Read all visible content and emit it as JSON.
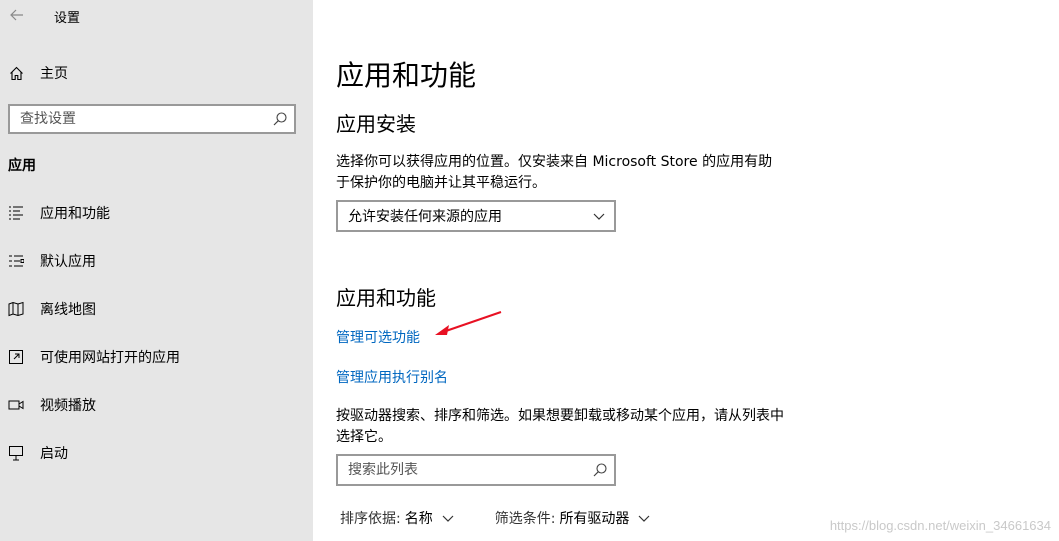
{
  "window": {
    "title": "设置"
  },
  "sidebar": {
    "home_label": "主页",
    "search_placeholder": "查找设置",
    "section_label": "应用",
    "items": [
      {
        "label": "应用和功能",
        "icon": "list-icon"
      },
      {
        "label": "默认应用",
        "icon": "default-apps-icon"
      },
      {
        "label": "离线地图",
        "icon": "map-icon"
      },
      {
        "label": "可使用网站打开的应用",
        "icon": "open-in-icon"
      },
      {
        "label": "视频播放",
        "icon": "video-icon"
      },
      {
        "label": "启动",
        "icon": "startup-icon"
      }
    ]
  },
  "main": {
    "title": "应用和功能",
    "install_section": {
      "heading": "应用安装",
      "description": "选择你可以获得应用的位置。仅安装来自 Microsoft Store 的应用有助于保护你的电脑并让其平稳运行。",
      "dropdown_value": "允许安装任何来源的应用"
    },
    "features_section": {
      "heading": "应用和功能",
      "link_optional": "管理可选功能",
      "link_alias": "管理应用执行别名",
      "description": "按驱动器搜索、排序和筛选。如果想要卸载或移动某个应用，请从列表中选择它。",
      "search_placeholder": "搜索此列表",
      "sort_key": "排序依据:",
      "sort_value": "名称",
      "filter_key": "筛选条件:",
      "filter_value": "所有驱动器"
    }
  },
  "watermark": "https://blog.csdn.net/weixin_34661634",
  "colors": {
    "sidebar_bg": "#e6e6e6",
    "link": "#0067c0",
    "annotation_arrow": "#e81123"
  }
}
